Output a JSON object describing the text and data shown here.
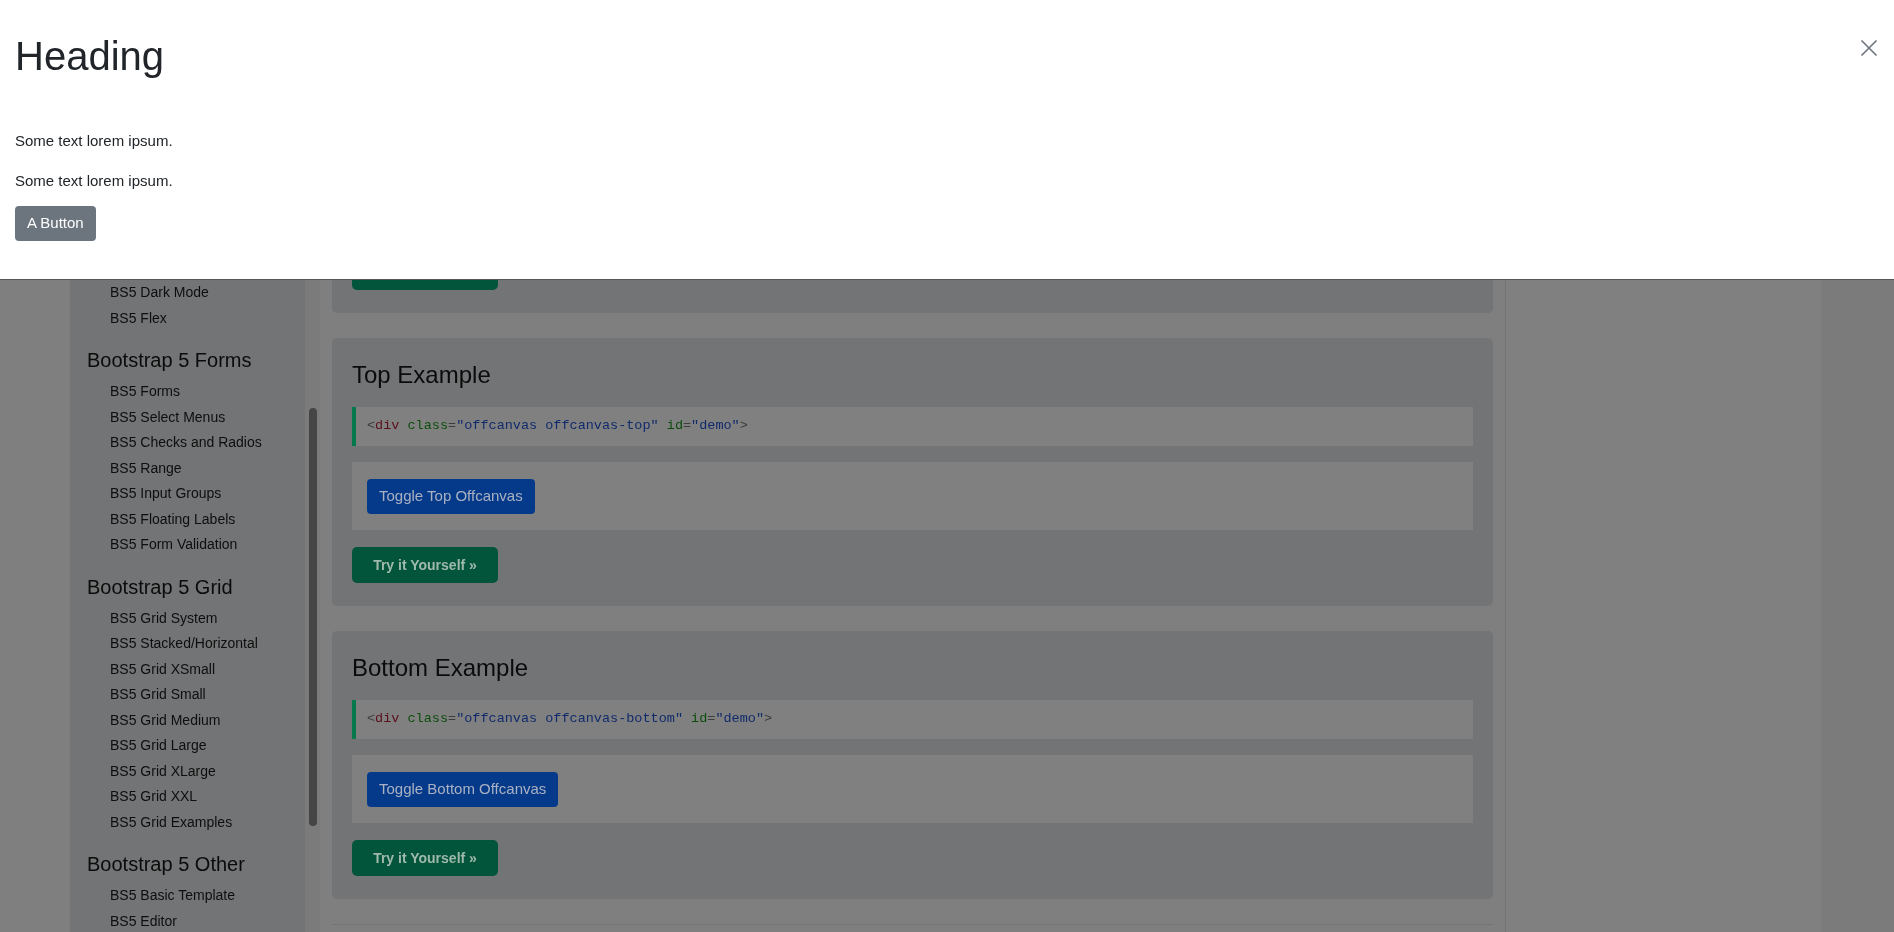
{
  "offcanvas": {
    "heading": "Heading",
    "paragraphs": [
      "Some text lorem ipsum.",
      "Some text lorem ipsum."
    ],
    "button": "A Button"
  },
  "sidebar": {
    "items": [
      "BS5 Dark Mode",
      "BS5 Flex"
    ],
    "sections": [
      {
        "title": "Bootstrap 5 Forms",
        "items": [
          "BS5 Forms",
          "BS5 Select Menus",
          "BS5 Checks and Radios",
          "BS5 Range",
          "BS5 Input Groups",
          "BS5 Floating Labels",
          "BS5 Form Validation"
        ]
      },
      {
        "title": "Bootstrap 5 Grid",
        "items": [
          "BS5 Grid System",
          "BS5 Stacked/Horizontal",
          "BS5 Grid XSmall",
          "BS5 Grid Small",
          "BS5 Grid Medium",
          "BS5 Grid Large",
          "BS5 Grid XLarge",
          "BS5 Grid XXL",
          "BS5 Grid Examples"
        ]
      },
      {
        "title": "Bootstrap 5 Other",
        "items": [
          "BS5 Basic Template",
          "BS5 Editor"
        ]
      }
    ]
  },
  "examples": [
    {
      "title": "Top Example",
      "code": [
        {
          "kind": "punct",
          "text": "<"
        },
        {
          "kind": "tag",
          "text": "div"
        },
        {
          "kind": "attr",
          "text": " class"
        },
        {
          "kind": "punct",
          "text": "="
        },
        {
          "kind": "value",
          "text": "\"offcanvas offcanvas-top\""
        },
        {
          "kind": "attr",
          "text": " id"
        },
        {
          "kind": "punct",
          "text": "="
        },
        {
          "kind": "value",
          "text": "\"demo\""
        },
        {
          "kind": "punct",
          "text": ">"
        }
      ],
      "toggle_button": "Toggle Top Offcanvas",
      "try_button": "Try it Yourself »"
    },
    {
      "title": "Bottom Example",
      "code": [
        {
          "kind": "punct",
          "text": "<"
        },
        {
          "kind": "tag",
          "text": "div"
        },
        {
          "kind": "attr",
          "text": " class"
        },
        {
          "kind": "punct",
          "text": "="
        },
        {
          "kind": "value",
          "text": "\"offcanvas offcanvas-bottom\""
        },
        {
          "kind": "attr",
          "text": " id"
        },
        {
          "kind": "punct",
          "text": "="
        },
        {
          "kind": "value",
          "text": "\"demo\""
        },
        {
          "kind": "punct",
          "text": ">"
        }
      ],
      "toggle_button": "Toggle Bottom Offcanvas",
      "try_button": "Try it Yourself »"
    }
  ]
}
